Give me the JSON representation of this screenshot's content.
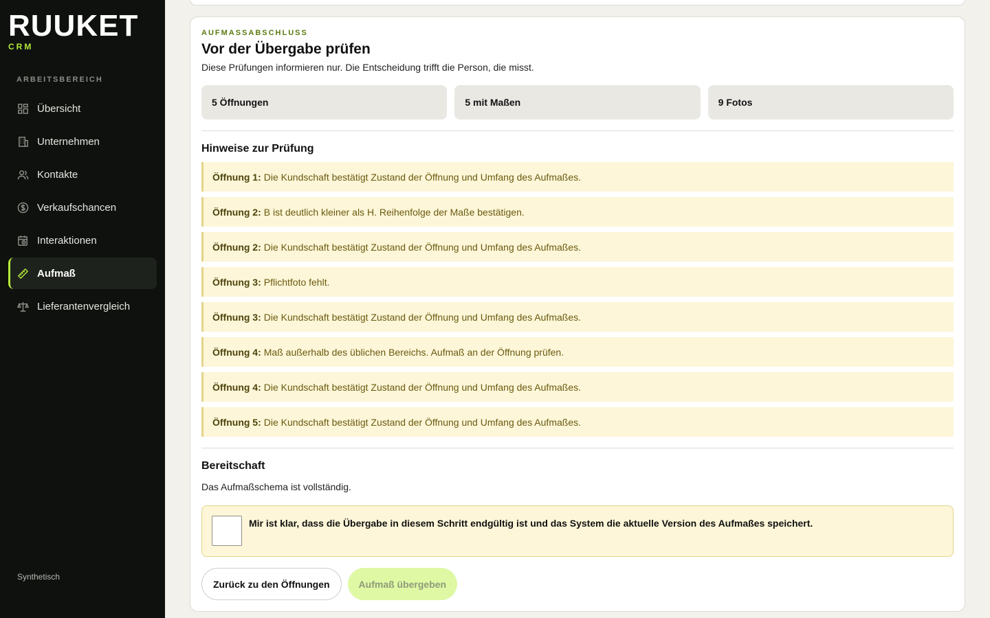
{
  "brand": {
    "name": "RUUKET",
    "sub": "CRM"
  },
  "sidebar": {
    "section_label": "ARBEITSBEREICH",
    "items": [
      {
        "label": "Übersicht",
        "icon": "dashboard-icon"
      },
      {
        "label": "Unternehmen",
        "icon": "building-icon"
      },
      {
        "label": "Kontakte",
        "icon": "users-icon"
      },
      {
        "label": "Verkaufschancen",
        "icon": "dollar-icon"
      },
      {
        "label": "Interaktionen",
        "icon": "calendar-clock-icon"
      },
      {
        "label": "Aufmaß",
        "icon": "ruler-icon",
        "active": true
      },
      {
        "label": "Lieferantenvergleich",
        "icon": "scale-icon"
      }
    ],
    "footer": "Synthetisch"
  },
  "main": {
    "eyebrow": "AUFMASSABSCHLUSS",
    "title": "Vor der Übergabe prüfen",
    "subtitle": "Diese Prüfungen informieren nur. Die Entscheidung trifft die Person, die misst.",
    "stats": [
      "5 Öffnungen",
      "5 mit Maßen",
      "9 Fotos"
    ],
    "hints_title": "Hinweise zur Prüfung",
    "hints": [
      {
        "label": "Öffnung 1:",
        "text": "Die Kundschaft bestätigt Zustand der Öffnung und Umfang des Aufmaßes."
      },
      {
        "label": "Öffnung 2:",
        "text": "B ist deutlich kleiner als H. Reihenfolge der Maße bestätigen."
      },
      {
        "label": "Öffnung 2:",
        "text": "Die Kundschaft bestätigt Zustand der Öffnung und Umfang des Aufmaßes."
      },
      {
        "label": "Öffnung 3:",
        "text": "Pflichtfoto fehlt."
      },
      {
        "label": "Öffnung 3:",
        "text": "Die Kundschaft bestätigt Zustand der Öffnung und Umfang des Aufmaßes."
      },
      {
        "label": "Öffnung 4:",
        "text": "Maß außerhalb des üblichen Bereichs. Aufmaß an der Öffnung prüfen."
      },
      {
        "label": "Öffnung 4:",
        "text": "Die Kundschaft bestätigt Zustand der Öffnung und Umfang des Aufmaßes."
      },
      {
        "label": "Öffnung 5:",
        "text": "Die Kundschaft bestätigt Zustand der Öffnung und Umfang des Aufmaßes."
      }
    ],
    "readiness_title": "Bereitschaft",
    "readiness_text": "Das Aufmaßschema ist vollständig.",
    "confirm_text": "Mir ist klar, dass die Übergabe in diesem Schritt endgültig ist und das System die aktuelle Version des Aufmaßes speichert.",
    "confirm_checked": false,
    "back_label": "Zurück zu den Öffnungen",
    "submit_label": "Aufmaß übergeben"
  },
  "colors": {
    "accent": "#b5ea3c",
    "sidebar_bg": "#0e110d",
    "hint_bg": "#fdf6d8",
    "primary_btn_bg": "#dff8a4"
  }
}
